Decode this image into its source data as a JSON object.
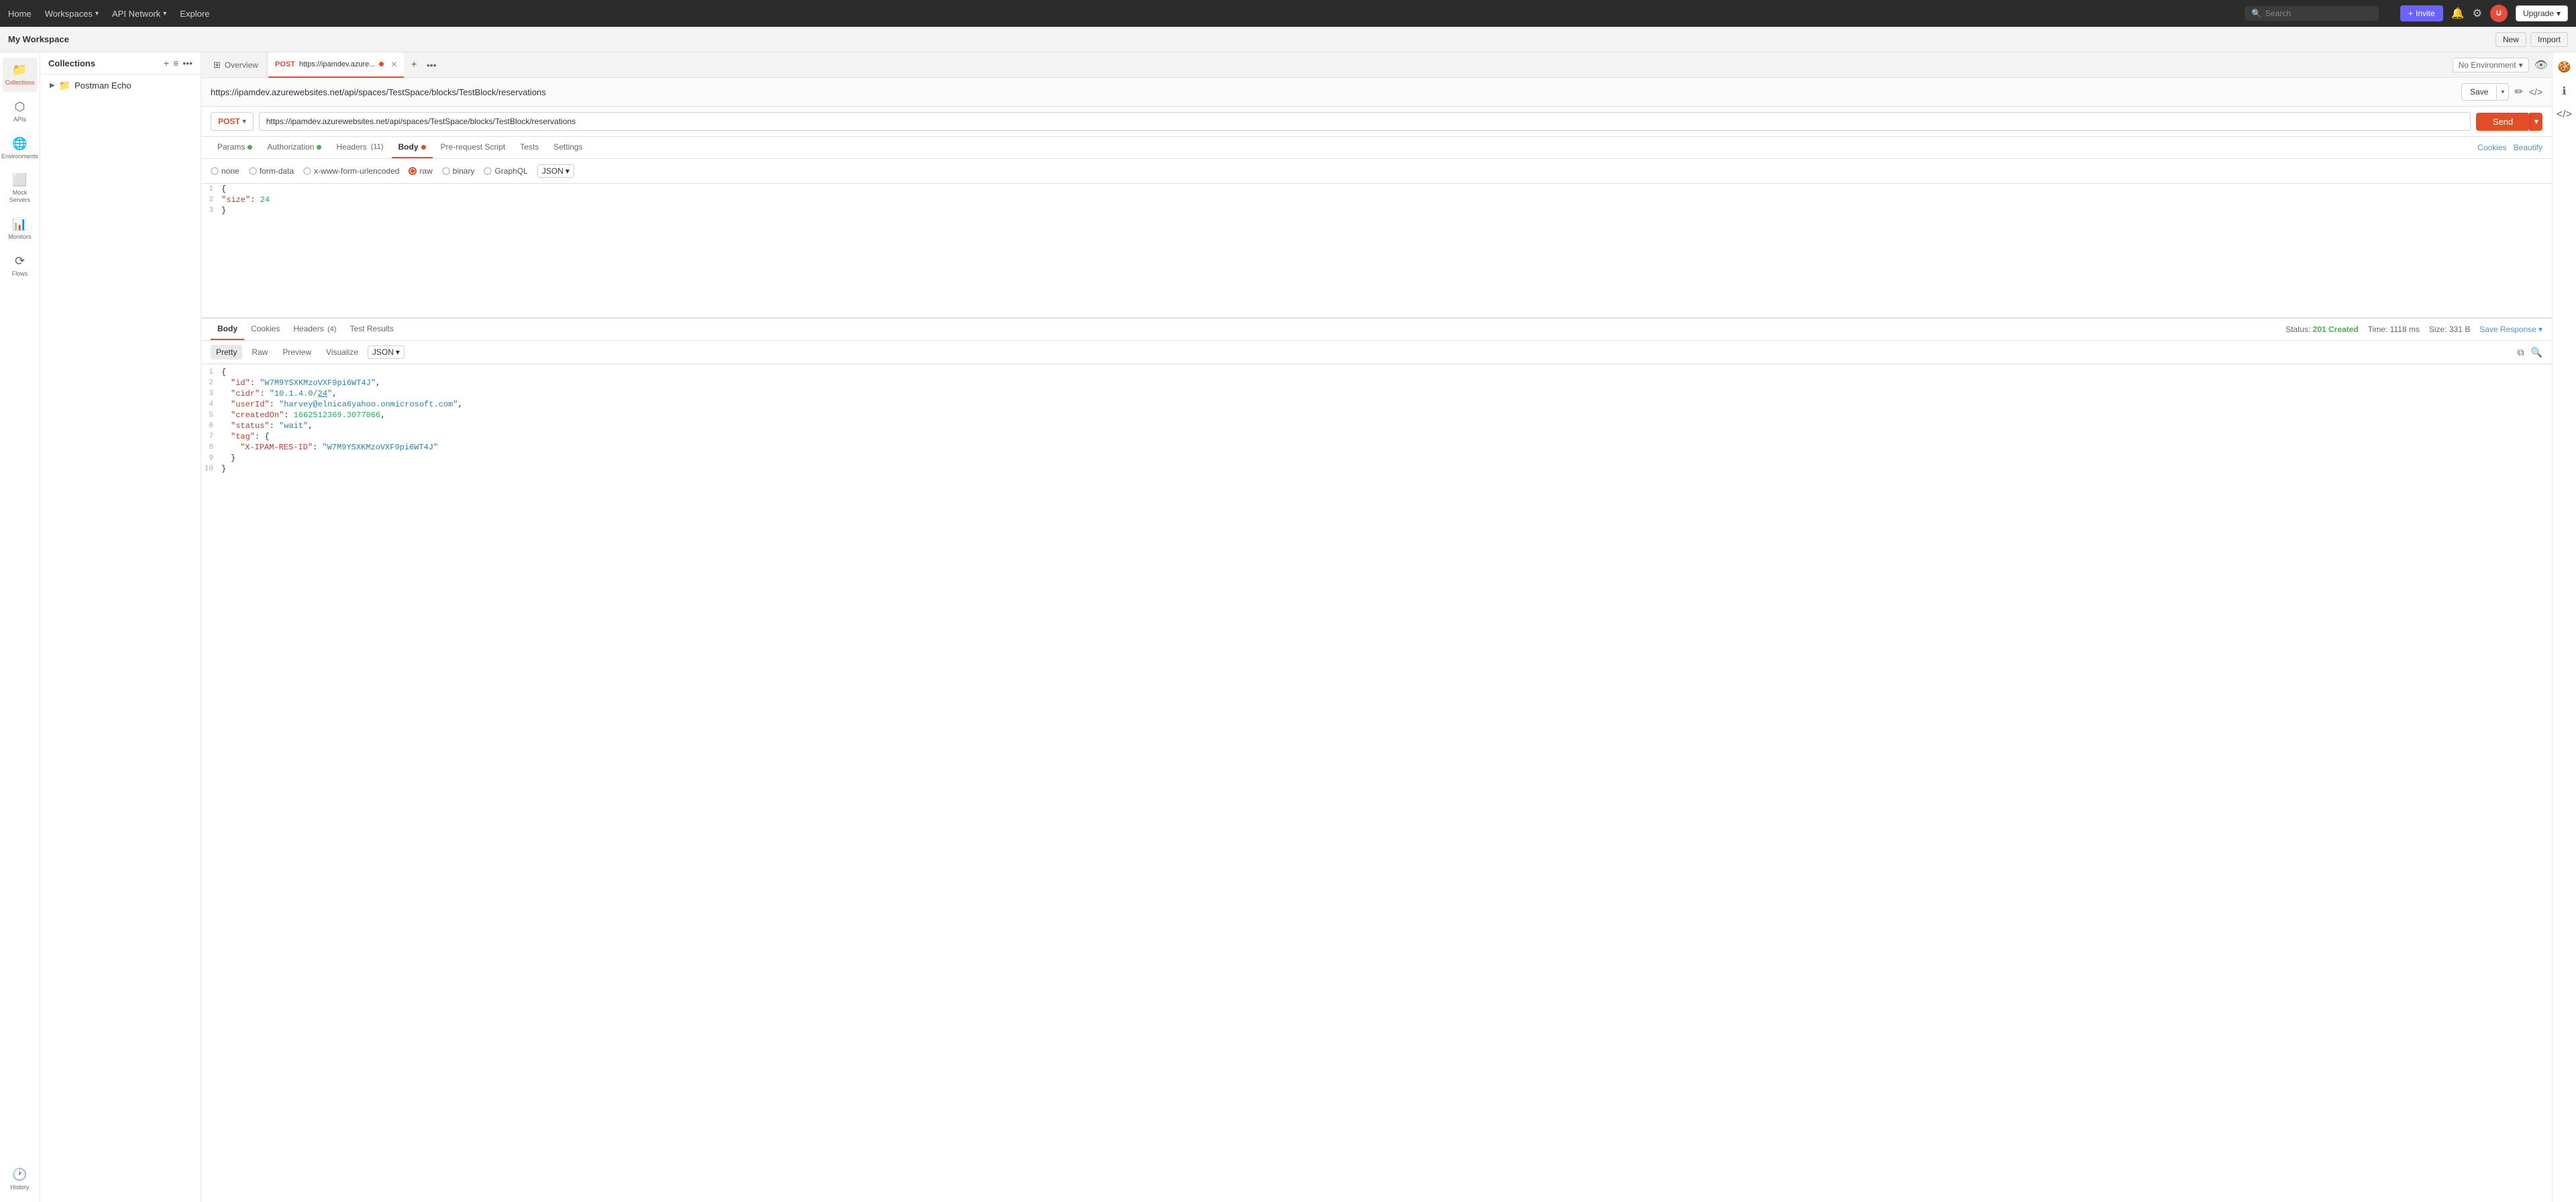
{
  "topnav": {
    "home": "Home",
    "workspaces": "Workspaces",
    "api_network": "API Network",
    "explore": "Explore",
    "search_placeholder": "Search",
    "invite_label": "Invite",
    "upgrade_label": "Upgrade"
  },
  "workspace": {
    "name": "My Workspace",
    "new_label": "New",
    "import_label": "Import"
  },
  "sidebar": {
    "collections_label": "Collections",
    "apis_label": "APIs",
    "environments_label": "Environments",
    "mock_servers_label": "Mock Servers",
    "monitors_label": "Monitors",
    "flows_label": "Flows",
    "history_label": "History"
  },
  "left_panel": {
    "title": "Collections",
    "collection_name": "Postman Echo"
  },
  "tabs": {
    "overview_label": "Overview",
    "active_tab_method": "POST",
    "active_tab_url": "https://ipamdev.azure...",
    "add_tab": "+",
    "more_tabs": "•••"
  },
  "env_selector": {
    "label": "No Environment"
  },
  "url_bar": {
    "full_url": "https://ipamdev.azurewebsites.net/api/spaces/TestSpace/blocks/TestBlock/reservations"
  },
  "request": {
    "method": "POST",
    "url": "https://ipamdev.azurewebsites.net/api/spaces/TestSpace/blocks/TestBlock/reservations",
    "send_label": "Send",
    "tabs": {
      "params": "Params",
      "authorization": "Authorization",
      "headers": "Headers",
      "headers_count": "11",
      "body": "Body",
      "pre_request": "Pre-request Script",
      "tests": "Tests",
      "settings": "Settings"
    },
    "cookies_link": "Cookies",
    "beautify_link": "Beautify",
    "body_types": {
      "none": "none",
      "form_data": "form-data",
      "url_encoded": "x-www-form-urlencoded",
      "raw": "raw",
      "binary": "binary",
      "graphql": "GraphQL",
      "json": "JSON"
    },
    "body_content": [
      {
        "line": 1,
        "text": "{"
      },
      {
        "line": 2,
        "text": "    \"size\": 24"
      },
      {
        "line": 3,
        "text": "}"
      }
    ]
  },
  "response": {
    "tabs": {
      "body": "Body",
      "cookies": "Cookies",
      "headers": "Headers",
      "headers_count": "4",
      "test_results": "Test Results"
    },
    "status_label": "Status:",
    "status_value": "201 Created",
    "time_label": "Time:",
    "time_value": "1118 ms",
    "size_label": "Size:",
    "size_value": "331 B",
    "save_response": "Save Response",
    "sub_tabs": {
      "pretty": "Pretty",
      "raw": "Raw",
      "preview": "Preview",
      "visualize": "Visualize"
    },
    "format": "JSON",
    "body_lines": [
      {
        "line": 1,
        "content": "{"
      },
      {
        "line": 2,
        "content": "    \"id\": \"W7M9YSXKMzoVXF9pi6WT4J\","
      },
      {
        "line": 3,
        "content": "    \"cidr\": \"10.1.4.0/24\","
      },
      {
        "line": 4,
        "content": "    \"userId\": \"harvey@elnica6yahoo.onmicrosoft.com\","
      },
      {
        "line": 5,
        "content": "    \"createdOn\": 1662512369.3077066,"
      },
      {
        "line": 6,
        "content": "    \"status\": \"wait\","
      },
      {
        "line": 7,
        "content": "    \"tag\": {"
      },
      {
        "line": 8,
        "content": "        \"X-IPAM-RES-ID\": \"W7M9YSXKMzoVXF9pi6WT4J\""
      },
      {
        "line": 9,
        "content": "    }"
      },
      {
        "line": 10,
        "content": "}"
      }
    ]
  }
}
